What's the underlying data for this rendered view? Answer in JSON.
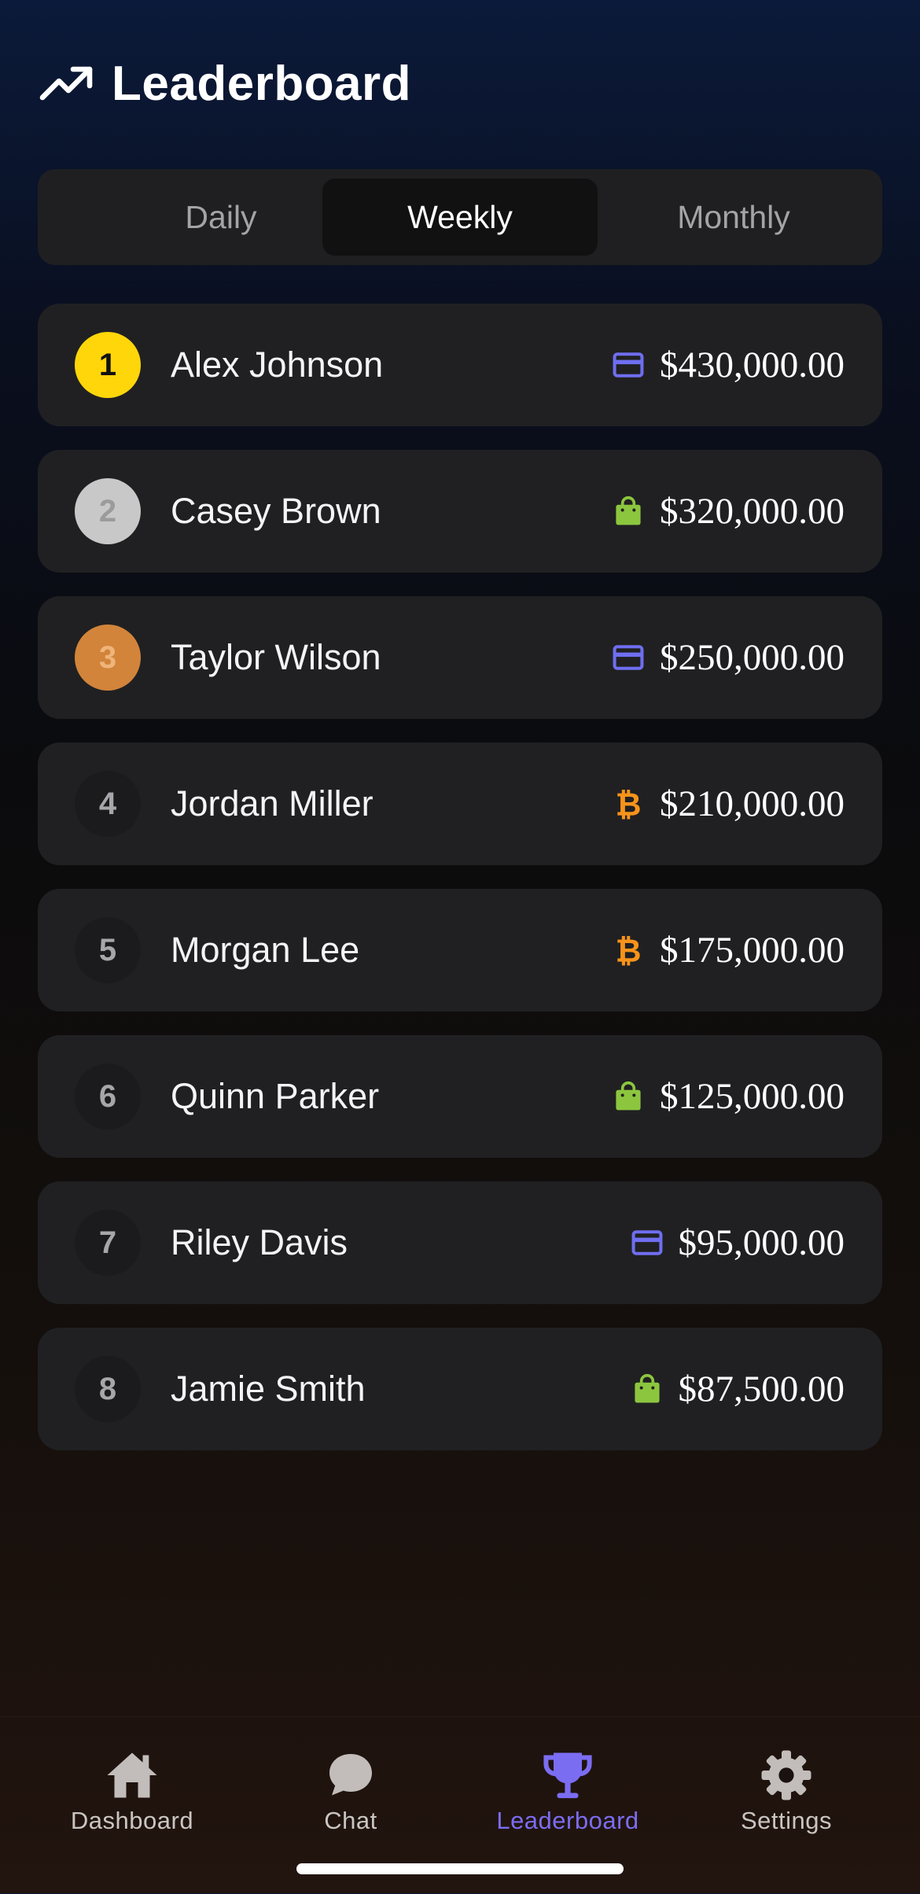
{
  "header": {
    "title": "Leaderboard",
    "icon": "trending-up-icon"
  },
  "tabs": [
    {
      "label": "Daily",
      "active": false
    },
    {
      "label": "Weekly",
      "active": true
    },
    {
      "label": "Monthly",
      "active": false
    }
  ],
  "leaderboard": [
    {
      "rank": "1",
      "name": "Alex Johnson",
      "amount": "$430,000.00",
      "icon": "credit-card-icon"
    },
    {
      "rank": "2",
      "name": "Casey Brown",
      "amount": "$320,000.00",
      "icon": "shopping-bag-icon"
    },
    {
      "rank": "3",
      "name": "Taylor Wilson",
      "amount": "$250,000.00",
      "icon": "credit-card-icon"
    },
    {
      "rank": "4",
      "name": "Jordan Miller",
      "amount": "$210,000.00",
      "icon": "bitcoin-icon"
    },
    {
      "rank": "5",
      "name": "Morgan Lee",
      "amount": "$175,000.00",
      "icon": "bitcoin-icon"
    },
    {
      "rank": "6",
      "name": "Quinn Parker",
      "amount": "$125,000.00",
      "icon": "shopping-bag-icon"
    },
    {
      "rank": "7",
      "name": "Riley Davis",
      "amount": "$95,000.00",
      "icon": "credit-card-icon"
    },
    {
      "rank": "8",
      "name": "Jamie Smith",
      "amount": "$87,500.00",
      "icon": "shopping-bag-icon"
    }
  ],
  "nav": [
    {
      "label": "Dashboard",
      "icon": "home-icon",
      "active": false
    },
    {
      "label": "Chat",
      "icon": "chat-bubble-icon",
      "active": false
    },
    {
      "label": "Leaderboard",
      "icon": "trophy-icon",
      "active": true
    },
    {
      "label": "Settings",
      "icon": "gear-icon",
      "active": false
    }
  ],
  "colors": {
    "gold": "#ffd60a",
    "silver": "#c8c8c8",
    "bronze": "#d2843a",
    "card_icon": "#6f6ef0",
    "bag_icon": "#8cc63f",
    "bitcoin_icon": "#f7931a",
    "accent": "#7b6df2"
  }
}
